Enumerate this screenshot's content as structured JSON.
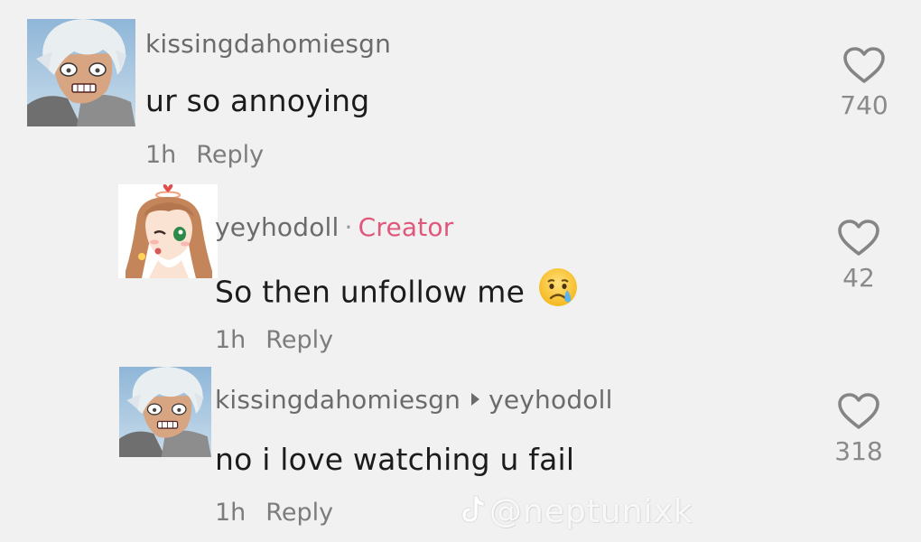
{
  "comments": [
    {
      "username": "kissingdahomiesgn",
      "text": "ur so annoying",
      "time": "1h",
      "reply_label": "Reply",
      "likes": "740"
    },
    {
      "username": "yeyhodoll",
      "separator": "·",
      "badge": "Creator",
      "text": "So then unfollow me",
      "emoji": "crying-face",
      "time": "1h",
      "reply_label": "Reply",
      "likes": "42"
    },
    {
      "username": "kissingdahomiesgn",
      "reply_to": "yeyhodoll",
      "text": "no i love watching u fail",
      "time": "1h",
      "reply_label": "Reply",
      "likes": "318"
    }
  ],
  "watermark": {
    "handle": "@neptunixk",
    "icon": "tiktok-logo-icon"
  },
  "colors": {
    "background": "#f1f1f1",
    "creator_badge": "#e0577c",
    "secondary_text": "#7c7c7c"
  }
}
